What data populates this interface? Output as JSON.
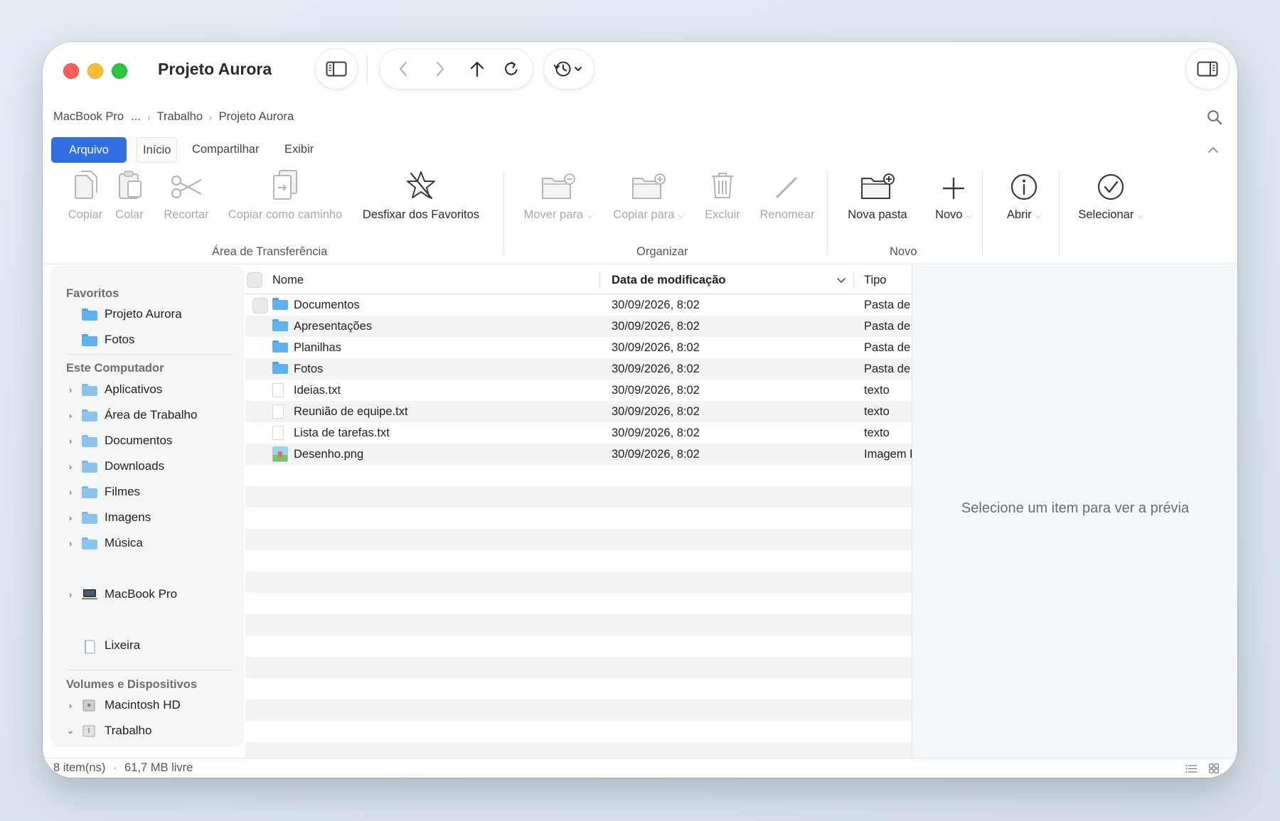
{
  "window": {
    "title": "Projeto Aurora"
  },
  "breadcrumb": [
    "MacBook Pro",
    "...",
    "Trabalho",
    "Projeto Aurora"
  ],
  "tabs": [
    "Arquivo",
    "Início",
    "Compartilhar",
    "Exibir"
  ],
  "ribbon": {
    "clipboard": {
      "label": "Área de Transferência",
      "items": [
        "Copiar",
        "Colar",
        "Recortar",
        "Copiar como caminho",
        "Desfixar dos Favoritos"
      ]
    },
    "organize": {
      "label": "Organizar",
      "items": [
        "Mover para",
        "Copiar para",
        "Excluir",
        "Renomear"
      ]
    },
    "new": {
      "label": "Novo",
      "items": [
        "Nova pasta",
        "Novo"
      ]
    },
    "open": {
      "label": "Abrir"
    },
    "select": {
      "label": "Selecionar"
    }
  },
  "sidebar": {
    "favorites": {
      "heading": "Favoritos",
      "items": [
        "Projeto Aurora",
        "Fotos"
      ]
    },
    "computer": {
      "heading": "Este Computador",
      "items": [
        "Aplicativos",
        "Área de Trabalho",
        "Documentos",
        "Downloads",
        "Filmes",
        "Imagens",
        "Música"
      ]
    },
    "macbook": "MacBook Pro",
    "trash": "Lixeira",
    "volumes": {
      "heading": "Volumes e Dispositivos",
      "items": [
        "Macintosh HD",
        "Trabalho"
      ]
    }
  },
  "columns": {
    "name": "Nome",
    "date": "Data de modificação",
    "type": "Tipo"
  },
  "files": [
    {
      "name": "Documentos",
      "date": "30/09/2026, 8:02",
      "type": "Pasta de arquivos",
      "icon": "folder"
    },
    {
      "name": "Apresentações",
      "date": "30/09/2026, 8:02",
      "type": "Pasta de arquivos",
      "icon": "folder"
    },
    {
      "name": "Planilhas",
      "date": "30/09/2026, 8:02",
      "type": "Pasta de arquivos",
      "icon": "folder"
    },
    {
      "name": "Fotos",
      "date": "30/09/2026, 8:02",
      "type": "Pasta de arquivos",
      "icon": "folder"
    },
    {
      "name": "Ideias.txt",
      "date": "30/09/2026, 8:02",
      "type": "texto",
      "icon": "text-file"
    },
    {
      "name": "Reunião de equipe.txt",
      "date": "30/09/2026, 8:02",
      "type": "texto",
      "icon": "text-file"
    },
    {
      "name": "Lista de tarefas.txt",
      "date": "30/09/2026, 8:02",
      "type": "texto",
      "icon": "text-file"
    },
    {
      "name": "Desenho.png",
      "date": "30/09/2026, 8:02",
      "type": "Imagem PNG",
      "icon": "image-file"
    }
  ],
  "preview": {
    "placeholder": "Selecione um item para ver a prévia"
  },
  "status": {
    "count": "8 item(ns)",
    "separator": "·",
    "free": "61,7 MB livre"
  },
  "colors": {
    "accent": "#2f6fe0",
    "folder": "#5fb2f0"
  }
}
